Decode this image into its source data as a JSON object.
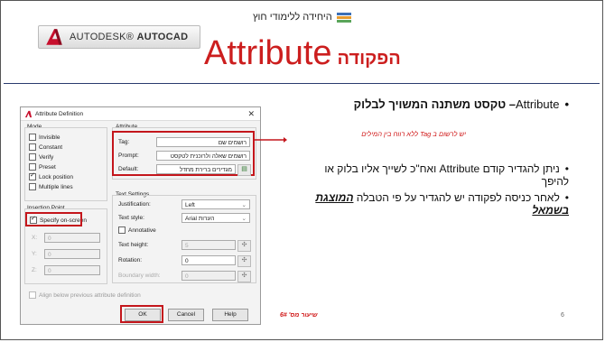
{
  "header": {
    "autocad_logo_text_a": "AUTODESK",
    "autocad_logo_text_b": "AUTOCAD",
    "yehida_text": "היחידה ללימודי חוץ",
    "title_en": "Attribute",
    "title_he": "הפקודה"
  },
  "dialog": {
    "title": "Attribute Definition",
    "mode_label": "Mode",
    "mode_items": [
      {
        "label": "Invisible",
        "checked": false
      },
      {
        "label": "Constant",
        "checked": false
      },
      {
        "label": "Verify",
        "checked": false
      },
      {
        "label": "Preset",
        "checked": false
      },
      {
        "label": "Lock position",
        "checked": true
      },
      {
        "label": "Multiple lines",
        "checked": false
      }
    ],
    "insertion_label": "Insertion Point",
    "specify_onscreen": "Specify on-screen",
    "x_label": "X:",
    "x_value": "0",
    "y_label": "Y:",
    "y_value": "0",
    "z_label": "Z:",
    "z_value": "0",
    "attribute_label": "Attribute",
    "tag_label": "Tag:",
    "tag_value": "רושמים שם",
    "prompt_label": "Prompt:",
    "prompt_value": "רושמים שאלה ולרוכנית לטקסט",
    "default_label": "Default:",
    "default_value": "מגדירים ברירת מחדל",
    "text_settings_label": "Text Settings",
    "justification_label": "Justification:",
    "justification_value": "Left",
    "text_style_label": "Text style:",
    "text_style_value": "Arial הערות",
    "annotative_label": "Annotative",
    "text_height_label": "Text height:",
    "text_height_value": "5",
    "rotation_label": "Rotation:",
    "rotation_value": "0",
    "boundary_label": "Boundary width:",
    "boundary_value": "0",
    "align_below_label": "Align below previous attribute definition",
    "ok": "OK",
    "cancel": "Cancel",
    "help": "Help"
  },
  "note": "יש לרשום ב Tag ללא רווח בין המילים",
  "bullets": {
    "b1_en": "Attribute",
    "b1_he": "– טקסט משתנה המשויך לבלוק",
    "b2": "ניתן להגדיר קודם Attribute ואח\"כ לשייך אליו בלוק או להיפך",
    "b3_a": "לאחר כניסה לפקודה יש להגדיר על פי הטבלה",
    "b3_b": "המוצגת בשמאל"
  },
  "footer": {
    "lesson": "שיעור מס' 6#",
    "page": "6"
  },
  "colors": {
    "accent_red": "#c4161c",
    "rule_blue": "#2a3b6e"
  }
}
